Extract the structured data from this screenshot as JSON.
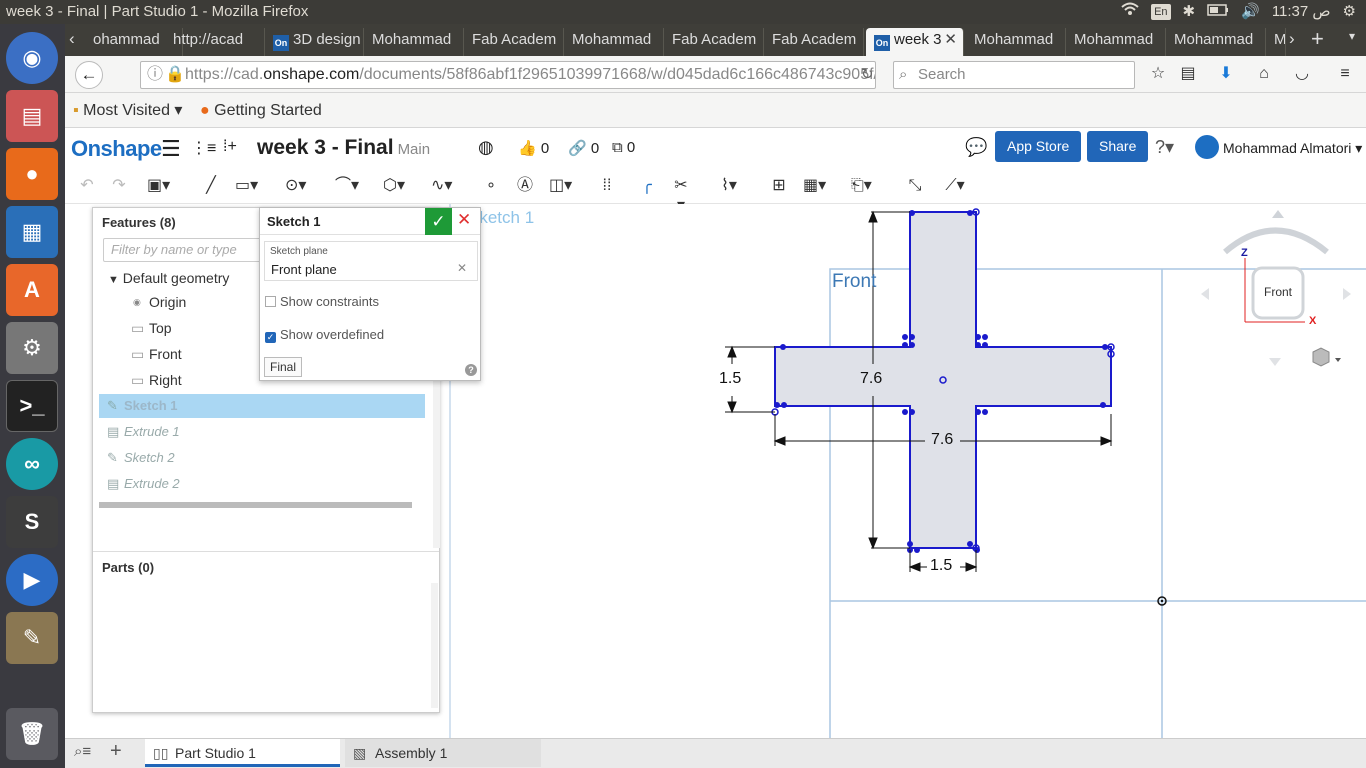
{
  "window_title": "week 3 - Final | Part Studio 1 - Mozilla Firefox",
  "system": {
    "lang": "En",
    "clock": "11:37 ص"
  },
  "tabs": [
    {
      "label": "ohammad"
    },
    {
      "label": "http://acad"
    },
    {
      "label": "3D design"
    },
    {
      "label": "Mohammad"
    },
    {
      "label": "Fab Academ"
    },
    {
      "label": "Mohammad"
    },
    {
      "label": "Fab Academ"
    },
    {
      "label": "Fab Academ"
    },
    {
      "label": "week 3"
    },
    {
      "label": "Mohammad"
    },
    {
      "label": "Mohammad"
    },
    {
      "label": "Mohammad"
    },
    {
      "label": "M"
    }
  ],
  "tab_fav": "On",
  "nav": {
    "url_prefix": "https://cad.",
    "url_host": "onshape.com",
    "url_rest": "/documents/58f86abf1f29651039971668/w/d045dad6c166c486743c905f/e,",
    "search_placeholder": "Search"
  },
  "bookmarks": {
    "most_visited": "Most Visited",
    "getting_started": "Getting Started"
  },
  "onshape": {
    "logo": "Onshape",
    "doc_title": "week 3 - Final",
    "branch": "Main",
    "likes": "0",
    "links": "0",
    "copies": "0",
    "app_store": "App Store",
    "share": "Share",
    "user": "Mohammad Almatori"
  },
  "features": {
    "header": "Features (8)",
    "filter_placeholder": "Filter by name or type",
    "default_geometry": "Default geometry",
    "items": [
      "Origin",
      "Top",
      "Front",
      "Right",
      "Sketch 1",
      "Extrude 1",
      "Sketch 2",
      "Extrude 2"
    ],
    "parts": "Parts (0)"
  },
  "sketch_dialog": {
    "title": "Sketch 1",
    "plane_label": "Sketch plane",
    "plane_value": "Front plane",
    "show_constraints": "Show constraints",
    "show_constraints_checked": false,
    "show_overdefined": "Show overdefined",
    "show_overdefined_checked": true,
    "final": "Final"
  },
  "viewport": {
    "sketch_label": "Sketch 1",
    "plane_label": "Front",
    "dimensions": {
      "height_main": "7.6",
      "width_main": "7.6",
      "bar_thickness": "1.5",
      "stem_width": "1.5"
    },
    "view_cube": {
      "face": "Front",
      "axis_z": "Z",
      "axis_x": "X"
    }
  },
  "bottom_tabs": [
    "Part Studio 1",
    "Assembly 1"
  ],
  "colors": {
    "accent": "#2166b8",
    "sketch": "#1a1acc",
    "fill": "#dfe1e8",
    "plane": "#aac6e2"
  }
}
